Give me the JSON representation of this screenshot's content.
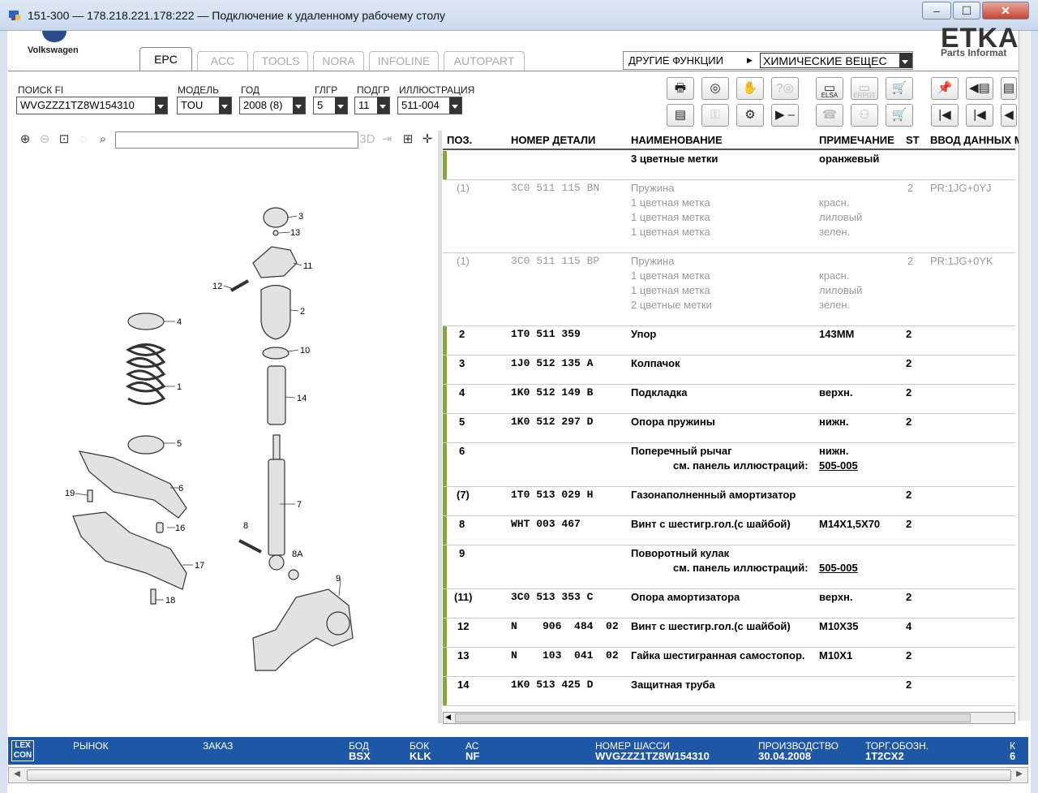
{
  "window": {
    "title": "151-300 — 178.218.221.178:222 — Подключение к удаленному рабочему столу"
  },
  "brand": {
    "vw": "Volkswagen",
    "etka": "ETKA",
    "etka_sub": "Parts Informat"
  },
  "tabs": [
    "EPC",
    "ACC",
    "TOOLS",
    "NORA",
    "INFOLINE",
    "AUTOPART"
  ],
  "other": {
    "label": "ДРУГИЕ ФУНКЦИИ",
    "value": "ХИМИЧЕСКИЕ ВЕЩЕС"
  },
  "filters": {
    "fi_label": "ПОИСК FI",
    "fi_value": "WVGZZZ1TZ8W154310",
    "model_label": "МОДЕЛЬ",
    "model_value": "TOU",
    "year_label": "ГОД",
    "year_value": "2008 (8)",
    "hg_label": "ГЛГР",
    "hg_value": "5",
    "ug_label": "ПОДГР",
    "ug_value": "11",
    "ill_label": "ИЛЛЮСТРАЦИЯ",
    "ill_value": "511-004"
  },
  "toolbar": {
    "elsa": "ELSA",
    "erpot": "ERPOT"
  },
  "table": {
    "headers": {
      "pos": "ПОЗ.",
      "part": "НОМЕР ДЕТАЛИ",
      "name": "НАИМЕНОВАНИЕ",
      "note": "ПРИМЕЧАНИЕ",
      "st": "ST",
      "input": "ВВОД ДАННЫХ М"
    },
    "rows": [
      {
        "pos": "",
        "part": "",
        "name": "3 цветные метки",
        "note": "оранжевый",
        "st": "",
        "input": ""
      },
      {
        "pos": "(1)",
        "part": "3C0  511  115  BN",
        "name": "Пружина",
        "note": "",
        "st": "2",
        "input": "PR:1JG+0YJ",
        "sub": [
          {
            "name": "1 цветная метка",
            "note": "красн."
          },
          {
            "name": "1 цветная метка",
            "note": "лиловый"
          },
          {
            "name": "1 цветная метка",
            "note": "зелен."
          }
        ]
      },
      {
        "pos": "(1)",
        "part": "3C0  511  115  BP",
        "name": "Пружина",
        "note": "",
        "st": "2",
        "input": "PR:1JG+0YK",
        "sub": [
          {
            "name": "1 цветная метка",
            "note": "красн."
          },
          {
            "name": "1 цветная метка",
            "note": "лиловый"
          },
          {
            "name": "2 цветные метки",
            "note": "зелен."
          }
        ]
      },
      {
        "pos": "2",
        "part": "1T0  511  359",
        "name": "Упор",
        "note": "143ММ",
        "st": "2"
      },
      {
        "pos": "3",
        "part": "1J0  512  135  A",
        "name": "Колпачок",
        "note": "",
        "st": "2"
      },
      {
        "pos": "4",
        "part": "1K0  512  149  B",
        "name": "Подкладка",
        "note": "верхн.",
        "st": "2"
      },
      {
        "pos": "5",
        "part": "1K0  512  297  D",
        "name": "Опора пружины",
        "note": "нижн.",
        "st": "2"
      },
      {
        "pos": "6",
        "part": "",
        "name": "Поперечный рычаг",
        "note": "нижн.",
        "st": "",
        "see": "см. панель иллюстраций:",
        "link": "505-005"
      },
      {
        "pos": "(7)",
        "part": "1T0  513  029  H",
        "name": "Газонаполненный амортизатор",
        "note": "",
        "st": "2"
      },
      {
        "pos": "8",
        "part": "WHT  003  467",
        "name": "Винт с шестигр.гол.(с шайбой)",
        "note": "M14X1,5X70",
        "st": "2"
      },
      {
        "pos": "9",
        "part": "",
        "name": "Поворотный кулак",
        "note": "",
        "st": "",
        "see": "см. панель иллюстраций:",
        "link": "505-005"
      },
      {
        "pos": "(11)",
        "part": "3C0  513  353  C",
        "name": "Опора амортизатора",
        "note": "верхн.",
        "st": "2"
      },
      {
        "pos": "12",
        "part": "N    906  484  02",
        "name": "Винт с шестигр.гол.(с шайбой)",
        "note": "M10X35",
        "st": "4"
      },
      {
        "pos": "13",
        "part": "N    103  041  02",
        "name": "Гайка шестигранная самостопор.",
        "note": "M10X1",
        "st": "2"
      },
      {
        "pos": "14",
        "part": "1K0  513  425  D",
        "name": "Защитная труба",
        "note": "",
        "st": "2"
      }
    ]
  },
  "illustration": {
    "labels": [
      "3",
      "13",
      "11",
      "12",
      "2",
      "10",
      "14",
      "4",
      "1",
      "5",
      "6",
      "19",
      "16",
      "17",
      "18",
      "7",
      "8",
      "8A",
      "9"
    ]
  },
  "status": {
    "lex": "LEX CON",
    "market_label": "РЫНОК",
    "market_value": "",
    "order_label": "ЗАКАЗ",
    "order_value": "",
    "bod_label": "БОД",
    "bod_value": "BSX",
    "bok_label": "БОК",
    "bok_value": "KLK",
    "ac_label": "АС",
    "ac_value": "NF",
    "chassis_label": "НОМЕР ШАССИ",
    "chassis_value": "WVGZZZ1TZ8W154310",
    "prod_label": "ПРОИЗВОДСТВО",
    "prod_value": "30.04.2008",
    "trade_label": "ТОРГ.ОБОЗН.",
    "trade_value": "1T2CX2",
    "k_label": "К",
    "k_value": "6"
  }
}
